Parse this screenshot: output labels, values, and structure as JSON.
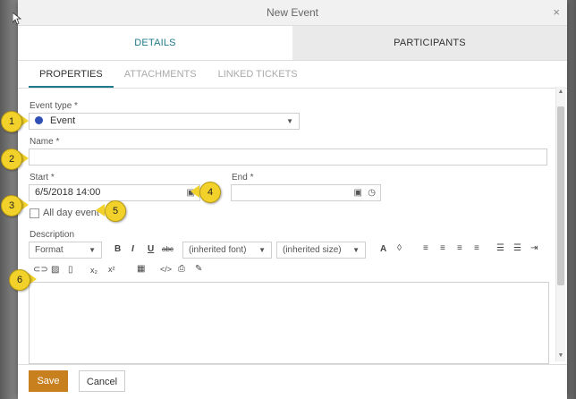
{
  "dialog": {
    "title": "New Event",
    "close_glyph": "×"
  },
  "main_tabs": [
    {
      "label": "DETAILS",
      "active": true
    },
    {
      "label": "PARTICIPANTS",
      "active": false
    }
  ],
  "sub_tabs": [
    {
      "label": "PROPERTIES",
      "active": true
    },
    {
      "label": "ATTACHMENTS",
      "active": false
    },
    {
      "label": "LINKED TICKETS",
      "active": false
    }
  ],
  "form": {
    "event_type": {
      "label": "Event type *",
      "value": "Event",
      "dot_color": "#2f4fb5"
    },
    "name": {
      "label": "Name *",
      "value": ""
    },
    "start": {
      "label": "Start *",
      "value": "6/5/2018 14:00"
    },
    "end": {
      "label": "End *",
      "value": ""
    },
    "all_day": {
      "label": "All day event",
      "checked": false
    },
    "description": {
      "label": "Description"
    }
  },
  "editor_toolbar": {
    "format": "Format",
    "font": "(inherited font)",
    "size": "(inherited size)",
    "bold": "B",
    "italic": "I",
    "underline": "U",
    "strike": "abc",
    "text_color": "A",
    "subscript": "x₂",
    "superscript": "x²"
  },
  "footer": {
    "save_label": "Save",
    "cancel_label": "Cancel"
  },
  "annotations": [
    "1",
    "2",
    "3",
    "4",
    "5",
    "6"
  ],
  "colors": {
    "accent": "#1f7a8c",
    "save_button": "#c8801f",
    "callout": "#f2d22a"
  }
}
